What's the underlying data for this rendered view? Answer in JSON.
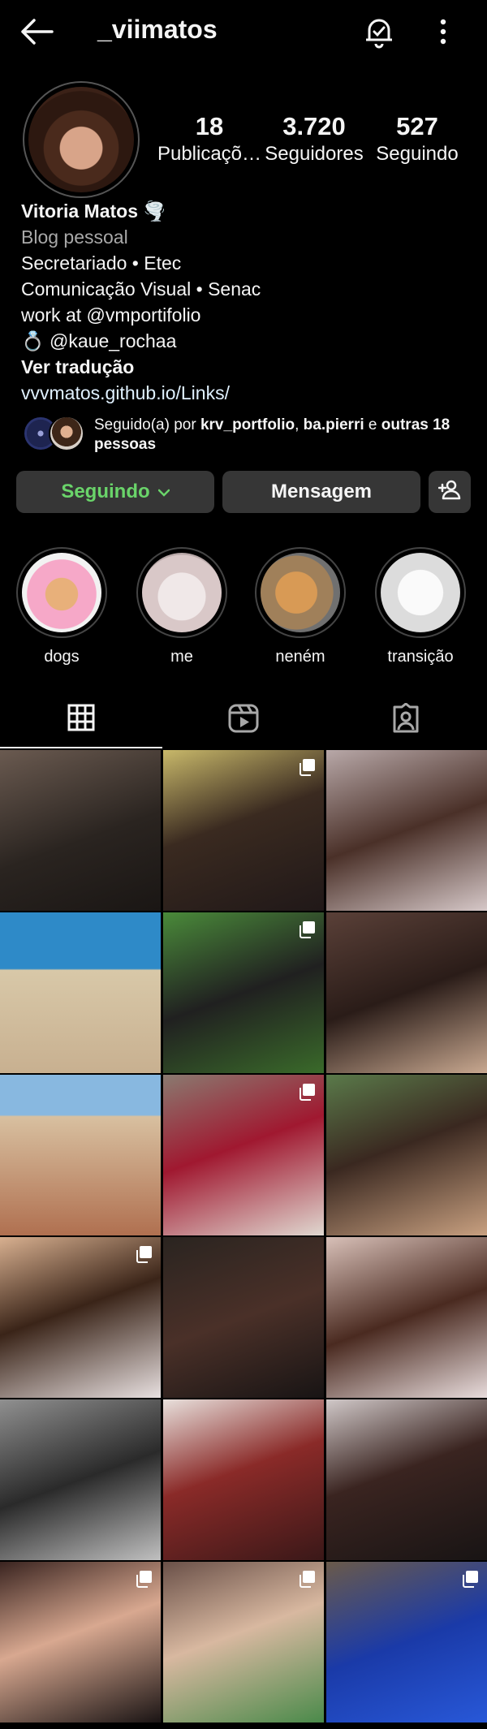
{
  "header": {
    "username": "_viimatos"
  },
  "stats": [
    {
      "value": "18",
      "label": "Publicaçõ…"
    },
    {
      "value": "3.720",
      "label": "Seguidores"
    },
    {
      "value": "527",
      "label": "Seguindo"
    }
  ],
  "bio": {
    "name": "Vitoria Matos 🌪️",
    "category": "Blog pessoal",
    "lines": [
      "Secretariado • Etec",
      "Comunicação Visual • Senac",
      "work at @vmportifolio",
      "💍 @kaue_rochaa"
    ],
    "translate": "Ver tradução",
    "link": "vvvmatos.github.io/Links/"
  },
  "followed_by": {
    "prefix": "Seguido(a) por ",
    "user1": "krv_portfolio",
    "sep": ", ",
    "user2": "ba.pierri",
    "middle": " e ",
    "others": "outras 18 pessoas"
  },
  "buttons": {
    "following": "Seguindo",
    "message": "Mensagem"
  },
  "highlights": [
    "dogs",
    "me",
    "neném",
    "transição"
  ],
  "colors": {
    "accent_green": "#6ad46a",
    "button_bg": "#363636",
    "background": "#000000"
  },
  "grid": {
    "posts": [
      {
        "multi": false,
        "bg": "linear-gradient(160deg,#6a5a50,#2a2420 55%,#1a1614)"
      },
      {
        "multi": true,
        "bg": "linear-gradient(160deg,#c8b86a,#3a2a20 45%,#201818)"
      },
      {
        "multi": false,
        "bg": "linear-gradient(160deg,#b8a8a8,#4a3028 50%,#d6c8c8)"
      },
      {
        "multi": false,
        "bg": "linear-gradient(180deg,#2e8ac8 0 35%,#d8c8a8 36%,#c8b090)"
      },
      {
        "multi": true,
        "bg": "linear-gradient(160deg,#4a8a3a,#202020 50%,#3a6a2a)"
      },
      {
        "multi": false,
        "bg": "linear-gradient(160deg,#5a4038,#2a1c18 50%,#c8a890)"
      },
      {
        "multi": false,
        "bg": "linear-gradient(180deg,#88b8e0 0 25%,#d8c0a0 26%,#b07050)"
      },
      {
        "multi": true,
        "bg": "linear-gradient(160deg,#8a7a70,#a01830 45%,#e0d8d0)"
      },
      {
        "multi": false,
        "bg": "linear-gradient(160deg,#5a7a4a,#3a2820 45%,#c8a080)"
      },
      {
        "multi": true,
        "bg": "linear-gradient(160deg,#d8b090,#3a2418 45%,#e8e0e0)"
      },
      {
        "multi": false,
        "bg": "linear-gradient(160deg,#2a2420,#4a3028 50%,#181414)"
      },
      {
        "multi": false,
        "bg": "linear-gradient(160deg,#d8c0b8,#4a2a20 50%,#e8dcdc)"
      },
      {
        "multi": false,
        "bg": "linear-gradient(160deg,#909090,#2a2a2a 50%,#c0c0c0)"
      },
      {
        "multi": false,
        "bg": "linear-gradient(160deg,#e8e0dc,#8a2a28 45%,#3a1818)"
      },
      {
        "multi": false,
        "bg": "linear-gradient(160deg,#d0c8c8,#3a2420 45%,#181414)"
      },
      {
        "multi": true,
        "bg": "linear-gradient(160deg,#3a2420,#d8a890 45%,#1a1414)"
      },
      {
        "multi": true,
        "bg": "linear-gradient(160deg,#6a5048,#d8b8a0 45%,#4a8a4a)"
      },
      {
        "multi": true,
        "bg": "linear-gradient(160deg,#6a5a4a,#1a3aa8 50%,#2858d8)"
      }
    ]
  }
}
